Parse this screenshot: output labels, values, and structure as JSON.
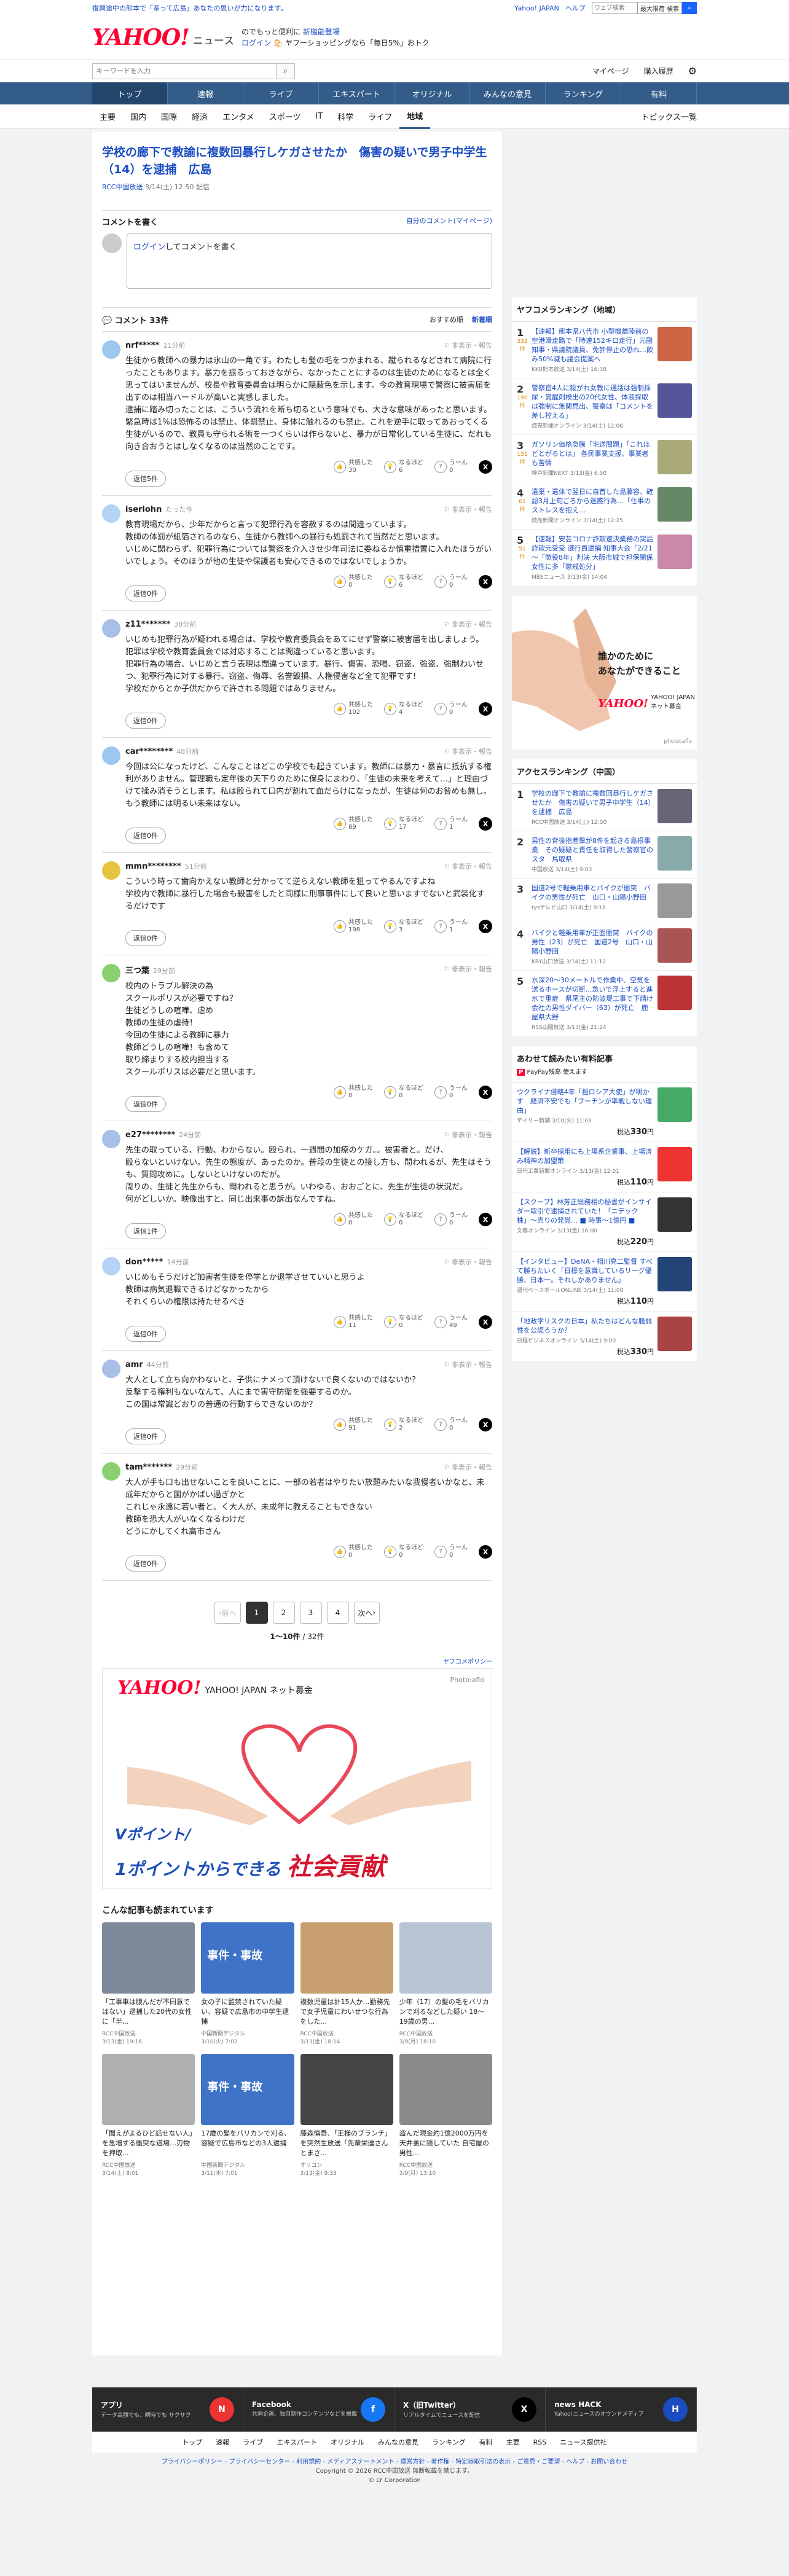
{
  "promo": {
    "text": "復興途中の熊本で「系って広島」あなたの思いが力になります。",
    "links": [
      "Yahoo! JAPAN",
      "ヘルプ"
    ],
    "search_placeholder": "ウェブ検索",
    "search_scope": "最大限荷 検索"
  },
  "header": {
    "logo": "YAHOO!",
    "logo_sub": "JAPAN",
    "section": "ニュース",
    "tag1": "のでもっと便利に",
    "tag1_link": "新機能登場",
    "tag2_link": "ログイン",
    "tag2": "ヤフーショッピングなら「毎日5%」おトク"
  },
  "searchbar": {
    "placeholder": "キーワードを入力",
    "links": [
      "マイページ",
      "購入履歴"
    ]
  },
  "nav": [
    "トップ",
    "速報",
    "ライブ",
    "エキスパート",
    "オリジナル",
    "みんなの意見",
    "ランキング",
    "有料"
  ],
  "subnav": [
    "主要",
    "国内",
    "国際",
    "経済",
    "エンタメ",
    "スポーツ",
    "IT",
    "科学",
    "ライフ",
    "地域"
  ],
  "subnav_active": "地域",
  "subnav_right": "トピックス一覧",
  "article": {
    "title": "学校の廊下で教諭に複数回暴行しケガさせたか　傷害の疑いで男子中学生（14）を逮捕　広島",
    "source": "RCC中国放送",
    "date": "3/14(土) 12:50 配信"
  },
  "comment_form": {
    "heading": "コメントを書く",
    "link": "自分のコメント(マイページ)",
    "login": "ログイン",
    "prompt": "してコメントを書く"
  },
  "comments_header": {
    "title": "コメント 33件",
    "sort": [
      "おすすめ順",
      "新着順"
    ]
  },
  "comments": [
    {
      "user": "nrf*****",
      "ago": "11分前",
      "report": "非表示・報告",
      "text": "生徒から教師への暴力は氷山の一角です。わたしも髪の毛をつかまれる、蹴られるなどされて病院に行ったこともあります。暴力を振るっておきながら、なかったことにするのは生徒のためになるとは全く思ってはいませんが、校長や教育委員会は明らかに隠蔽色を示します。今の教育現場で警察に被害届を出すのは相当ハードルが高いと実感しました。\n逮捕に踏み切ったことは、こういう流れを断ち切るという意味でも、大きな意味があったと思います。緊急時は1%は恐怖るのは禁止、体罰禁止、身体に触れるのも禁止。これを逆手に取ってあおってくる生徒がいるので、教員も守られる術を一つくらいは作らないと、暴力が日常化している生徒に、だれも向き合おうとはしなくなるのは当然のことです。",
      "counts": [
        "30",
        "6",
        "0"
      ],
      "reply": "返信5件",
      "color": "#9cc8f0"
    },
    {
      "user": "iserlohn",
      "ago": "たった今",
      "report": "非表示・報告",
      "text": "教育現場だから、少年だからと言って犯罪行為を容赦するのは間違っています。\n教師の体罰が紙箔されるのなら、生徒から教師への暴行も処罰されて当然だと思います。\nいじめに関わらず、犯罪行為については警察を介入させ少年司法に委ねるか慎重措置に入れたほうがいいでしょう。そのほうが他の生徒や保護者も安心できるのではないでしょうか。",
      "counts": [
        "0",
        "6",
        "0"
      ],
      "reply": "返信0件",
      "color": "#b5d3f6"
    },
    {
      "user": "z11*******",
      "ago": "38分前",
      "report": "非表示・報告",
      "text": "いじめも犯罪行為が疑われる場合は、学校や教育委員会をあてにせず警察に被害届を出しましょう。\n犯罪は学校や教育委員会では対応することは間違っていると思います。\n犯罪行為の場合、いじめと言う表現は間違っています。暴行、傷害、恐喝、窃盗、強盗、強制わいせつ、犯罪行為に対する暴行、窃盗、侮辱、名誉毀損、人権侵害など全て犯罪です！\n学校だからとか子供だからで許される問題ではありません。",
      "counts": [
        "102",
        "4",
        "0"
      ],
      "reply": "返信0件",
      "color": "#a8bfe6"
    },
    {
      "user": "car********",
      "ago": "48分前",
      "report": "非表示・報告",
      "text": "今回は公になったけど、こんなことはどこの学校でも起きています。教師には暴力・暴言に抵抗する権利がありません。管理職も定年後の天下りのために保身にまわり、「生徒の未来を考えて…」と理由づけて揉み消そうとします。私は殴られて口内が割れて血だらけになったが、生徒は何のお咎めも無し。もう教師には明るい未来はない。",
      "counts": [
        "89",
        "17",
        "1"
      ],
      "reply": "返信0件",
      "color": "#9cc8f0"
    },
    {
      "user": "mmn********",
      "ago": "51分前",
      "report": "非表示・報告",
      "text": "こういう時って歯向かえない教師と分かってて逆らえない教師を狙ってやるんですよね\n学校内で教師に暴行した場合も殺害をしたと同様に刑事事件にして良いと思いますでないと武装化するだけです",
      "counts": [
        "198",
        "3",
        "1"
      ],
      "reply": "返信0件",
      "color": "#e6c340"
    },
    {
      "user": "三つ葉",
      "ago": "29分前",
      "report": "非表示・報告",
      "text": "校内のトラブル解決の為\nスクールポリスが必要ですね？\n生徒どうしの喧嘩、虐め\n教師の生徒の虐待！\n今回の生徒による教師に暴力\n教師どうしの喧嘩！も含めて\n取り締まりする校内担当する\nスクールポリスは必要だと思います。",
      "counts": [
        "0",
        "0",
        "0"
      ],
      "reply": "返信0件",
      "color": "#8ad070"
    },
    {
      "user": "e27********",
      "ago": "24分前",
      "report": "非表示・報告",
      "text": "先生の取っている、行動、わからない。殴られ、一週間の加療のケガ。。被害者と。だけ、\n殴らないといけない。先生の態度が、あったのか。普段の生徒との接し方も、問われるが、先生はそうも、質問攻めに。しないといけないのだが。\n周りの、生徒と先生からも、問われると思うが。いわゆる、おおごとに、先生が生徒の状況だ。\n何がどしいか。映像出すと、同じ出来事の訴出なんですね。",
      "counts": [
        "0",
        "0",
        "0"
      ],
      "reply": "返信1件",
      "color": "#a8bfe6"
    },
    {
      "user": "don*****",
      "ago": "14分前",
      "report": "非表示・報告",
      "text": "いじめもそうだけど加害者生徒を停学とか退学させていいと思うよ\n教師は病気退職できるけどなかったから\nそれくらいの権限は持たせるべき",
      "counts": [
        "11",
        "0",
        "49"
      ],
      "reply": "返信0件",
      "color": "#b5d3f6"
    },
    {
      "user": "amr",
      "ago": "44分前",
      "report": "非表示・報告",
      "text": "大人として立ち向かわないと、子供にナメって頂けないで良くないのではないか？\n反撃する権利もないなんて、人にまで害守防衛を強要するのか。\nこの国は常識どおりの普通の行動すらできないのか？",
      "counts": [
        "91",
        "2",
        "0"
      ],
      "reply": "返信0件",
      "color": "#a8bfe6"
    },
    {
      "user": "tam*******",
      "ago": "29分前",
      "report": "非表示・報告",
      "text": "大人が手も口も出せないことを良いことに、一部の若者はやりたい放題みたいな我慢者いかなと、未成年だからと国がかばい過ぎかと\nこれじゃ永遠に若い者と。く大人が、未成年に教えることもできない\n教師を恐大人がいなくなるわけだ\nどうにかしてくれ高市さん",
      "counts": [
        "0",
        "0",
        "0"
      ],
      "reply": "返信0件",
      "color": "#8ad070"
    }
  ],
  "reaction_labels": [
    "共感した",
    "なるほど",
    "うーん"
  ],
  "pagination": {
    "prev": "前へ",
    "pages": [
      "1",
      "2",
      "3",
      "4"
    ],
    "next": "次へ",
    "count": "1〜10件",
    "total": "/ 32件"
  },
  "ad": {
    "label": "ヤフコメポリシー",
    "brand": "YAHOO! JAPAN ネット募金",
    "credit": "Photo:aflo",
    "line1": "Vポイント/",
    "line2": "1ポイントからできる",
    "line3": "社会貢献"
  },
  "related": {
    "title": "こんな記事も読まれています",
    "items": [
      {
        "title": "「工事車は腹んだが不同意ではない」逮捕した20代の女性に「半...",
        "src": "RCC中国放送",
        "date": "3/13(金) 19:16",
        "color": "#7d8a99",
        "label": ""
      },
      {
        "title": "女の子に監禁されていた疑い、容疑で広島市の中学生逮捕",
        "src": "中国新聞デジタル",
        "date": "3/10(火) 7:02",
        "color": "#3f73c8",
        "label": "事件・事故"
      },
      {
        "title": "複数児童は計15人か…勤務先で女子児童にわいせつな行為をした...",
        "src": "RCC中国放送",
        "date": "3/13(金) 18:14",
        "color": "#c8a070",
        "label": ""
      },
      {
        "title": "少年（17）の髪の毛をバリカンで刈るなどした疑い 18〜19歳の男...",
        "src": "RCC中国放送",
        "date": "3/9(月) 18:10",
        "color": "#b8c6d4",
        "label": ""
      },
      {
        "title": "「聞えがよるひど話せない人」を急増する衝突な道場…刃物を押取...",
        "src": "RCC中国放送",
        "date": "3/14(土) 8:01",
        "color": "#b0b0b0",
        "label": ""
      },
      {
        "title": "17歳の髪をバリカンで刈る、容疑で広島市などの3人逮捕",
        "src": "中国新聞デジタル",
        "date": "3/11(水) 7:01",
        "color": "#3f73c8",
        "label": "事件・事故"
      },
      {
        "title": "藤森慎吾、「王様のブランチ」を突然生放送「先輩栄達さんとまさ...",
        "src": "オリコン",
        "date": "3/13(金) 9:33",
        "color": "#444",
        "label": ""
      },
      {
        "title": "盗んだ現金約1億2000万円を天井裏に隠していた 自宅屋の男性...",
        "src": "RCC中国放送",
        "date": "3/9(月) 13:10",
        "color": "#8a8a8a",
        "label": ""
      }
    ]
  },
  "ranking_local": {
    "title": "ヤフコメランキング（地域）",
    "items": [
      {
        "num": "1",
        "cnt": "332",
        "cnt_label": "件",
        "title": "【速報】熊本県八代市 小型機離陸前の空港滑走路で「時速152キロ走行」元副知事・県議院議員、免許停止の恐れ…飲み50%減も議会提案へ",
        "src": "KKB熊本放送 3/14(土) 16:38",
        "color": "#c64"
      },
      {
        "num": "2",
        "cnt": "190",
        "cnt_label": "件",
        "title": "警察官4人に殺がれ女教に通話は強制採尿・覚醒剤検出の20代女性、体液採取は強制に無関見出、警察は「コメントを差し控える」",
        "src": "読売新聞オンライン 3/14(土) 12:06",
        "color": "#559"
      },
      {
        "num": "3",
        "cnt": "131",
        "cnt_label": "件",
        "title": "ガソリン価格急騰「宅送問題」「これほどとがるとは」 各民事業支援、事業者も苦情",
        "src": "神戸新聞NEXT 3/13(金) 6:50",
        "color": "#aa7"
      },
      {
        "num": "4",
        "cnt": "61",
        "cnt_label": "件",
        "title": "遺棄・遺体で翌日に自首した島藤容、確認3月上旬ごろから迷惑行為…「仕事のストレスを抱え…",
        "src": "読売新聞オンライン 3/14(土) 12:25",
        "color": "#686"
      },
      {
        "num": "5",
        "cnt": "51",
        "cnt_label": "件",
        "title": "【速報】安芸コロナ詐欺速決業務の実話詐欺元受受 選行員逮捕 知事大会「2/21～「懲役8年」判決 大阪市城で担保関係女性に多「懲戒処分」",
        "src": "MBSニュース 3/13(金) 14:04",
        "color": "#c8a"
      }
    ]
  },
  "side_ad": {
    "line1": "誰かのために",
    "line2": "あなたができること",
    "brand": "YAHOO! JAPAN ネット募金",
    "credit": "photo:aflo"
  },
  "ranking_access": {
    "title": "アクセスランキング（中国）",
    "items": [
      {
        "num": "1",
        "title": "学校の廊下で教諭に複数回暴行しケガさせたか　傷害の疑いで男子中学生（14）を逮捕　広島",
        "src": "RCC中国放送 3/14(土) 12:50",
        "color": "#667"
      },
      {
        "num": "2",
        "title": "男性の背後指差撃が8件を起きる島根事業　その疑疑と責任を取得した警察官のスタ　鳥取県",
        "src": "中国放送 3/14(土) 9:03",
        "color": "#8aa"
      },
      {
        "num": "3",
        "title": "国道2号で軽乗用車とバイクが衝突　バイクの男性が死亡　山口・山陽小野田",
        "src": "tysテレビ山口 3/14(土) 9:18",
        "color": "#999"
      },
      {
        "num": "4",
        "title": "バイクと軽乗用車が正面衝突　バイクの男性（23）が死亡　国道2号　山口・山陽小野田",
        "src": "KRY山口放送 3/14(土) 11:12",
        "color": "#a55"
      },
      {
        "num": "5",
        "title": "水深20～30メートルで作業中、空気を送るホースが切断…急いで浮上すると進水で重症　県尾主の防波堤工事で下請け会社の男性ダイバー（63）が死亡　鹿屋県大野",
        "src": "RSS山陽放送 3/13(金) 21:24",
        "color": "#b33"
      }
    ]
  },
  "paid": {
    "title": "あわせて読みたい有料記事",
    "sub": "PayPay残高 使えます",
    "items": [
      {
        "title": "ウクライナ侵略4年「担ロシア大使」が明かす　経済不安でも「プーチンが率戦しない理由」",
        "src": "デイリー新潮 3/10(火) 11:03",
        "price": "330",
        "color": "#4a6"
      },
      {
        "title": "【解説】新卒採用にも上場系企業事、上場済み精神の加盟策",
        "src": "日刊工業新聞オンライン 3/13(金) 12:01",
        "price": "110",
        "color": "#e33"
      },
      {
        "title": "【スクープ】林芳正総務相の秘書がインサイダー取引で逮捕されていた！「ニデック株」〜売りの発覚… ■ 時事〜1億円 ■",
        "src": "文春オンライン 3/13(金) 16:00",
        "price": "220",
        "color": "#333"
      },
      {
        "title": "【インタビュー】DeNA・相川亮二監督 すべて勝ちたいく「日標を意識しているリーグ優勝、日本一。それしかありません」",
        "src": "週刊ベースボールONLINE 3/14(土) 11:00",
        "price": "110",
        "color": "#247"
      },
      {
        "title": "「地政学リスクの日本」私たちはどんな脆弱性を公認ろうか？",
        "src": "日経ビジネスオンライン 3/14(土) 9:00",
        "price": "330",
        "color": "#a44"
      }
    ]
  },
  "footer": {
    "cells": [
      {
        "h": "アプリ",
        "d": "データ高額でも、瞬時でも サクサク",
        "icon": "N",
        "icolor": "#e33"
      },
      {
        "h": "Facebook",
        "d": "共同企画、独自制作コンテンツなどを掲載",
        "icon": "f",
        "icolor": "#1877f2"
      },
      {
        "h": "X（旧Twitter）",
        "d": "リアルタイムでニュースを配信",
        "icon": "X",
        "icolor": "#000"
      },
      {
        "h": "news HACK",
        "d": "Yahoo!ニュースのオウンドメディア",
        "icon": "H",
        "icolor": "#1b4dc1"
      }
    ],
    "links": [
      "トップ",
      "速報",
      "ライブ",
      "エキスパート",
      "オリジナル",
      "みんなの意見",
      "ランキング",
      "有料",
      "主要",
      "RSS",
      "ニュース提供社"
    ],
    "legal": "プライバシーポリシー - プライバシーセンター - 利用規約 - メディアステートメント - 運営方針 - 著作権 - 特定商取引法の表示 - ご意見・ご要望 - ヘルプ - お問い合わせ",
    "copy1": "Copyright © 2026 RCC中国放送 無断転載を禁じます。",
    "copy2": "© LY Corporation"
  }
}
